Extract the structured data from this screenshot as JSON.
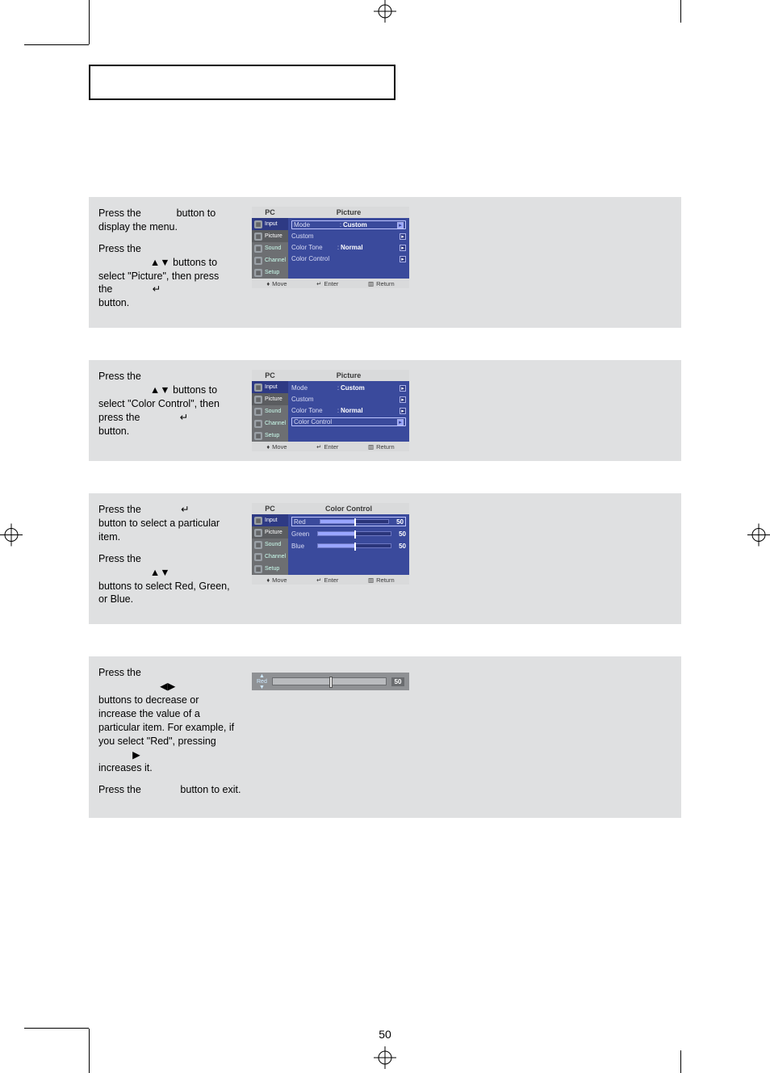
{
  "page_number": "50",
  "step1": {
    "p1_a": "Press the ",
    "p1_b": " button to display the menu.",
    "p2_a": "Press the ",
    "p2_b": " buttons to select \"Picture\", then press the ",
    "p2_c": " button."
  },
  "step2": {
    "p1_a": "Press the ",
    "p1_b": " buttons to select \"Color Control\", then press the ",
    "p1_c": " button."
  },
  "step3": {
    "p1_a": "Press the ",
    "p1_b": " button to select a particular item.",
    "p2_a": "Press the ",
    "p2_b": " buttons to select Red, Green, or Blue."
  },
  "step4": {
    "p1_a": "Press the ",
    "p1_b": " buttons to decrease or increase the value of a particular item. For example, if you select \"Red\", pressing ",
    "p1_c": " increases it.",
    "p2": "Press the              button to exit."
  },
  "osd_common": {
    "header_left": "PC",
    "tabs": [
      "Input",
      "Picture",
      "Sound",
      "Channel",
      "Setup"
    ],
    "footer_move": "Move",
    "footer_enter": "Enter",
    "footer_return": "Return"
  },
  "osd1": {
    "header_right": "Picture",
    "rows": [
      {
        "label": "Mode",
        "value": "Custom",
        "selected": true
      },
      {
        "label": "Custom",
        "value": "",
        "selected": false
      },
      {
        "label": "Color Tone",
        "value": "Normal",
        "selected": false
      },
      {
        "label": "Color Control",
        "value": "",
        "selected": false
      }
    ]
  },
  "osd2": {
    "header_right": "Picture",
    "rows": [
      {
        "label": "Mode",
        "value": "Custom",
        "selected": false
      },
      {
        "label": "Custom",
        "value": "",
        "selected": false
      },
      {
        "label": "Color Tone",
        "value": "Normal",
        "selected": false
      },
      {
        "label": "Color Control",
        "value": "",
        "selected": true
      }
    ]
  },
  "osd3": {
    "header_right": "Color Control",
    "items": [
      {
        "label": "Red",
        "value": 50,
        "selected": true
      },
      {
        "label": "Green",
        "value": 50,
        "selected": false
      },
      {
        "label": "Blue",
        "value": 50,
        "selected": false
      }
    ]
  },
  "red_slider": {
    "label": "Red",
    "up": "▲",
    "down": "▼",
    "value": 50
  }
}
